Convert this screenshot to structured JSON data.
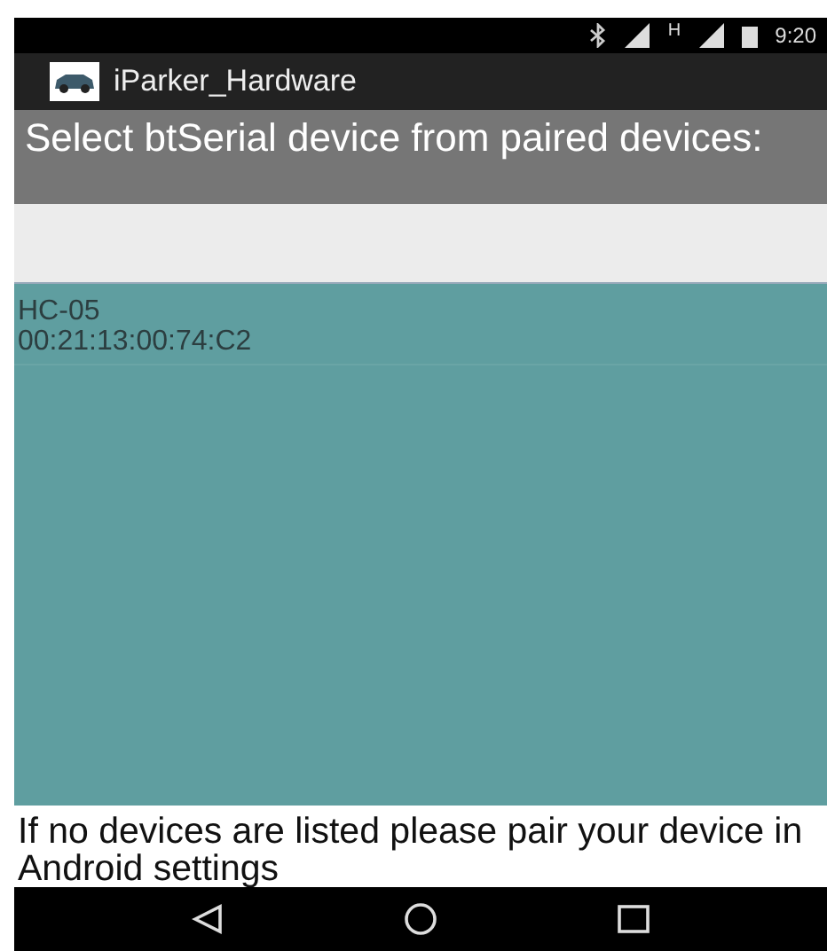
{
  "status_bar": {
    "time": "9:20",
    "network_label": "H"
  },
  "app_bar": {
    "title": "iParker_Hardware"
  },
  "header": {
    "text": "Select btSerial device from paired devices:"
  },
  "devices": [
    {
      "name": "HC-05",
      "address": "00:21:13:00:74:C2"
    }
  ],
  "footer": {
    "text": "If no devices are listed please pair your device in Android settings"
  }
}
